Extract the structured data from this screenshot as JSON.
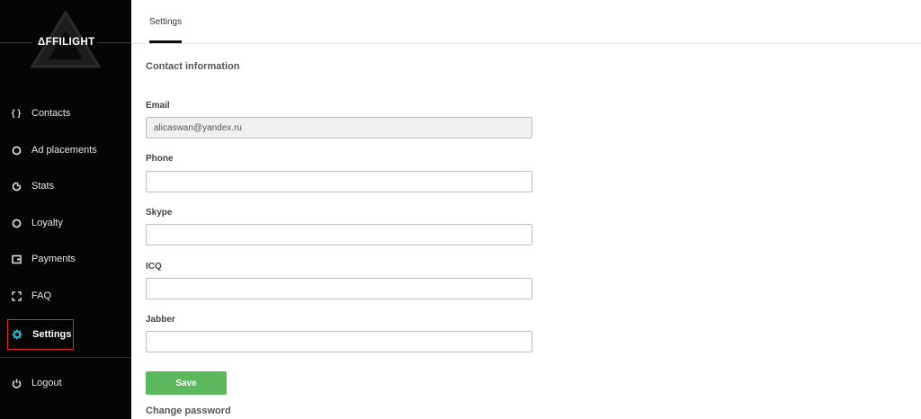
{
  "brand": {
    "name": "ΔFFILIGHT"
  },
  "sidebar": {
    "items": [
      {
        "label": "Contacts",
        "icon": "braces-icon"
      },
      {
        "label": "Ad placements",
        "icon": "circle-icon"
      },
      {
        "label": "Stats",
        "icon": "pie-chart-icon"
      },
      {
        "label": "Loyalty",
        "icon": "circle-icon"
      },
      {
        "label": "Payments",
        "icon": "wallet-icon"
      },
      {
        "label": "FAQ",
        "icon": "bracket-corners-icon"
      },
      {
        "label": "Settings",
        "icon": "gear-icon",
        "active": true
      }
    ],
    "logout_label": "Logout"
  },
  "header": {
    "tabs": [
      {
        "label": "Settings",
        "active": true
      }
    ]
  },
  "main": {
    "section_title": "Contact information",
    "fields": {
      "email": {
        "label": "Email",
        "value": "alicaswan@yandex.ru",
        "disabled": true
      },
      "phone": {
        "label": "Phone",
        "value": ""
      },
      "skype": {
        "label": "Skype",
        "value": ""
      },
      "icq": {
        "label": "ICQ",
        "value": ""
      },
      "jabber": {
        "label": "Jabber",
        "value": ""
      }
    },
    "save_label": "Save",
    "change_password_title": "Change password"
  },
  "colors": {
    "sidebar_bg": "#050505",
    "accent_green": "#5cb85c",
    "active_border": "#e0272f",
    "settings_icon": "#29b6c8"
  }
}
